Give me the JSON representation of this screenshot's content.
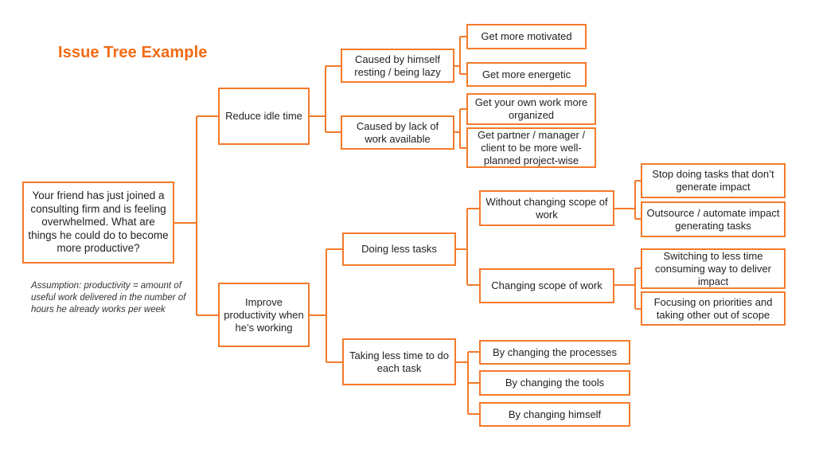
{
  "title": "Issue Tree Example",
  "colors": {
    "accent": "#f26a12",
    "box_border": "#f47a2a",
    "text": "#222222"
  },
  "root": {
    "text": "Your friend has just joined a consulting firm and is feeling overwhelmed. What are things he could do to become more productive?"
  },
  "assumption": "Assumption: productivity = amount of useful work delivered in the number of hours he already works per week",
  "branches": [
    {
      "text": "Reduce idle time",
      "children": [
        {
          "text": "Caused by himself resting / being lazy",
          "children": [
            {
              "text": "Get more motivated"
            },
            {
              "text": "Get more energetic"
            }
          ]
        },
        {
          "text": "Caused by lack of work available",
          "children": [
            {
              "text": "Get your own work more organized"
            },
            {
              "text": "Get partner / manager / client to be more well-planned project-wise"
            }
          ]
        }
      ]
    },
    {
      "text": "Improve productivity when he’s working",
      "children": [
        {
          "text": "Doing less tasks",
          "children": [
            {
              "text": "Without changing scope of work",
              "children": [
                {
                  "text": "Stop doing tasks that don’t generate impact"
                },
                {
                  "text": "Outsource / automate impact generating tasks"
                }
              ]
            },
            {
              "text": "Changing scope of work",
              "children": [
                {
                  "text": "Switching to less time consuming way to deliver impact"
                },
                {
                  "text": "Focusing on priorities and taking other out of scope"
                }
              ]
            }
          ]
        },
        {
          "text": "Taking less time to do each task",
          "children": [
            {
              "text": "By changing the processes"
            },
            {
              "text": "By changing the tools"
            },
            {
              "text": "By changing himself"
            }
          ]
        }
      ]
    }
  ]
}
